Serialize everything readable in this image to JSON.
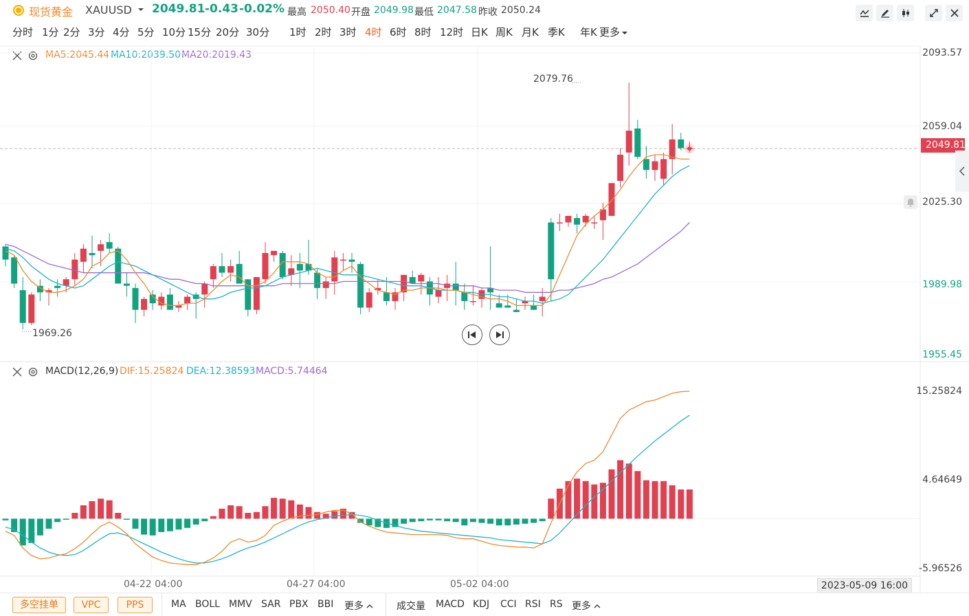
{
  "header": {
    "symbol_name": "现货黄金",
    "symbol_code": "XAUUSD",
    "last_price": "2049.81",
    "change": "-0.43",
    "change_pct": "-0.02%",
    "high_label": "最高",
    "high_value": "2050.40",
    "open_label": "开盘",
    "open_value": "2049.98",
    "low_label": "最低",
    "low_value": "2047.58",
    "prev_close_label": "昨收",
    "prev_close_value": "2050.24"
  },
  "periods": [
    "分时",
    "1分",
    "2分",
    "3分",
    "4分",
    "5分",
    "10分",
    "15分",
    "20分",
    "30分",
    "1时",
    "2时",
    "3时",
    "4时",
    "6时",
    "8时",
    "12时",
    "日K",
    "周K",
    "月K",
    "季K",
    "年K",
    "更多"
  ],
  "active_period": "4时",
  "main_legend": {
    "ma5": "MA5:2045.44",
    "ma10": "MA10:2039.50",
    "ma20": "MA20:2019.43"
  },
  "macd_legend": {
    "name": "MACD(12,26,9)",
    "dif": "DIF:15.25824",
    "dea": "DEA:12.38593",
    "macd": "MACD:5.74464"
  },
  "price_axis": [
    "2093.57",
    "2059.04",
    "2025.30",
    "1989.98",
    "1955.45"
  ],
  "current_price_tag": "2049.81",
  "macd_axis": [
    "15.25824",
    "4.64649",
    "-5.96526"
  ],
  "high_marker": "2079.76",
  "low_marker": "1969.26",
  "x_labels": [
    "04-22 04:00",
    "04-27 04:00",
    "05-02 04:00"
  ],
  "cursor_time": "2023-05-09 16:00",
  "bottom_chips": [
    "多空挂单",
    "VPC",
    "PPS"
  ],
  "main_indicators": [
    "MA",
    "BOLL",
    "MMV",
    "SAR",
    "PBX",
    "BBI",
    "更多"
  ],
  "sub_indicators": [
    "成交量",
    "MACD",
    "KDJ",
    "CCI",
    "RSI",
    "RS",
    "更多"
  ],
  "colors": {
    "up": "#e0404f",
    "down": "#11a37f",
    "ma5": "#f08a2c",
    "ma10": "#1eb3c9",
    "ma20": "#9a6ad6",
    "active": "#f0642c"
  },
  "chart_data": {
    "type": "candlestick",
    "y_range": [
      1955.45,
      2093.57
    ],
    "candles": [
      [
        2005,
        2006,
        1996,
        1999
      ],
      [
        2000,
        2001,
        1986,
        1988
      ],
      [
        1985,
        1991,
        1967,
        1970
      ],
      [
        1970,
        1984,
        1969,
        1983
      ],
      [
        1987,
        1990,
        1980,
        1984
      ],
      [
        1984,
        1986,
        1978,
        1985
      ],
      [
        1987,
        1990,
        1982,
        1986
      ],
      [
        1987,
        1991,
        1984,
        1990
      ],
      [
        1990,
        2002,
        1987,
        1999
      ],
      [
        1998,
        2006,
        1993,
        2004
      ],
      [
        2002,
        2010,
        1995,
        2001
      ],
      [
        2003,
        2008,
        1996,
        2006
      ],
      [
        2007,
        2011,
        2002,
        2004
      ],
      [
        2004,
        2005,
        1988,
        1988
      ],
      [
        1988,
        1993,
        1982,
        1987
      ],
      [
        1986,
        1988,
        1970,
        1976
      ],
      [
        1976,
        1982,
        1973,
        1981
      ],
      [
        1983,
        1985,
        1976,
        1979
      ],
      [
        1978,
        1984,
        1976,
        1982
      ],
      [
        1983,
        1986,
        1976,
        1976
      ],
      [
        1977,
        1980,
        1975,
        1978
      ],
      [
        1979,
        1983,
        1976,
        1982
      ],
      [
        1983,
        1984,
        1972,
        1981
      ],
      [
        1983,
        1989,
        1977,
        1988
      ],
      [
        1990,
        1997,
        1986,
        1996
      ],
      [
        1996,
        2002,
        1991,
        1993
      ],
      [
        1993,
        1999,
        1989,
        1996
      ],
      [
        1997,
        2003,
        1990,
        1988
      ],
      [
        1990,
        1990,
        1973,
        1976
      ],
      [
        1976,
        1991,
        1974,
        1991
      ],
      [
        1990,
        2007,
        1988,
        2002
      ],
      [
        2001,
        2003,
        1998,
        2003
      ],
      [
        2002,
        2003,
        1990,
        1991
      ],
      [
        1992,
        2001,
        1987,
        1995
      ],
      [
        1997,
        2002,
        1986,
        1994
      ],
      [
        1997,
        2008,
        1992,
        1994
      ],
      [
        1993,
        1995,
        1981,
        1986
      ],
      [
        1986,
        1991,
        1981,
        1989
      ],
      [
        1989,
        2003,
        1983,
        2000
      ],
      [
        1999,
        2002,
        1994,
        1999
      ],
      [
        1999,
        2002,
        1993,
        1998
      ],
      [
        1997,
        1998,
        1974,
        1977
      ],
      [
        1977,
        1986,
        1975,
        1984
      ],
      [
        1985,
        1990,
        1983,
        1986
      ],
      [
        1984,
        1991,
        1978,
        1980
      ],
      [
        1980,
        1986,
        1976,
        1984
      ],
      [
        1984,
        1991,
        1980,
        1992
      ],
      [
        1991,
        1994,
        1989,
        1988
      ],
      [
        1989,
        1993,
        1983,
        1992
      ],
      [
        1989,
        1991,
        1978,
        1983
      ],
      [
        1982,
        1991,
        1979,
        1985
      ],
      [
        1986,
        1992,
        1980,
        1988
      ],
      [
        1988,
        1998,
        1978,
        1985
      ],
      [
        1984,
        1988,
        1976,
        1980
      ],
      [
        1980,
        1987,
        1978,
        1980
      ],
      [
        1981,
        1986,
        1977,
        1985
      ],
      [
        1986,
        2005,
        1976,
        1984
      ],
      [
        1979,
        1983,
        1977,
        1977
      ],
      [
        1978,
        1983,
        1977,
        1977
      ],
      [
        1976,
        1981,
        1975,
        1975
      ],
      [
        1979,
        1982,
        1976,
        1980
      ],
      [
        1978,
        1983,
        1976,
        1976
      ],
      [
        1980,
        1986,
        1973,
        1982
      ],
      [
        2016,
        2018,
        1980,
        1990
      ],
      [
        2016,
        2020,
        2012,
        2016
      ],
      [
        2016,
        2019,
        2014,
        2019
      ],
      [
        2018,
        2020,
        2011,
        2015
      ],
      [
        2016,
        2020,
        2014,
        2019
      ],
      [
        2016,
        2019,
        2013,
        2016
      ],
      [
        2017,
        2025,
        2008,
        2022
      ],
      [
        2019,
        2029,
        2019,
        2034
      ],
      [
        2035,
        2050,
        2032,
        2047
      ],
      [
        2048,
        2080,
        2042,
        2058
      ],
      [
        2059,
        2063,
        2045,
        2046
      ],
      [
        2045,
        2051,
        2036,
        2040
      ],
      [
        2040,
        2047,
        2035,
        2044
      ],
      [
        2036,
        2048,
        2033,
        2045
      ],
      [
        2045,
        2061,
        2038,
        2054
      ],
      [
        2054,
        2057,
        2049,
        2050
      ],
      [
        2050,
        2053,
        2048,
        2050
      ]
    ],
    "ma5": [
      2003,
      2001,
      1994,
      1989,
      1986,
      1984,
      1984,
      1985,
      1987,
      1990,
      1996,
      1998,
      2002,
      2003,
      1999,
      1993,
      1988,
      1982,
      1979,
      1978,
      1978,
      1979,
      1979,
      1981,
      1985,
      1989,
      1992,
      1991,
      1987,
      1987,
      1989,
      1993,
      1998,
      1998,
      1998,
      1997,
      1993,
      1991,
      1991,
      1994,
      1996,
      1991,
      1988,
      1985,
      1984,
      1983,
      1985,
      1985,
      1986,
      1986,
      1986,
      1985,
      1985,
      1984,
      1983,
      1982,
      1981,
      1981,
      1980,
      1978,
      1978,
      1978,
      1978,
      1983,
      1992,
      2001,
      2010,
      2015,
      2019,
      2022,
      2026,
      2031,
      2037,
      2042,
      2046,
      2047,
      2047,
      2046,
      2045,
      2045
    ],
    "ma10": [
      2004,
      2003,
      2000,
      1996,
      1993,
      1990,
      1988,
      1987,
      1986,
      1987,
      1990,
      1993,
      1996,
      1998,
      1997,
      1996,
      1994,
      1992,
      1990,
      1988,
      1986,
      1984,
      1982,
      1981,
      1981,
      1982,
      1984,
      1985,
      1986,
      1986,
      1987,
      1989,
      1991,
      1992,
      1993,
      1994,
      1995,
      1994,
      1993,
      1992,
      1992,
      1992,
      1991,
      1990,
      1989,
      1988,
      1987,
      1987,
      1987,
      1986,
      1985,
      1985,
      1985,
      1984,
      1984,
      1983,
      1983,
      1982,
      1982,
      1981,
      1980,
      1980,
      1979,
      1980,
      1981,
      1983,
      1987,
      1991,
      1995,
      1999,
      2004,
      2009,
      2014,
      2019,
      2024,
      2029,
      2033,
      2037,
      2040,
      2042
    ],
    "ma20": [
      2006,
      2005,
      2003,
      2001,
      1999,
      1997,
      1996,
      1995,
      1994,
      1993,
      1993,
      1993,
      1993,
      1993,
      1993,
      1993,
      1993,
      1992,
      1991,
      1990,
      1990,
      1989,
      1988,
      1988,
      1987,
      1987,
      1987,
      1987,
      1987,
      1987,
      1987,
      1987,
      1988,
      1988,
      1988,
      1988,
      1988,
      1988,
      1988,
      1989,
      1989,
      1989,
      1989,
      1989,
      1989,
      1989,
      1989,
      1988,
      1988,
      1988,
      1988,
      1987,
      1987,
      1987,
      1987,
      1986,
      1986,
      1985,
      1985,
      1985,
      1984,
      1984,
      1984,
      1984,
      1985,
      1985,
      1986,
      1987,
      1988,
      1990,
      1991,
      1993,
      1995,
      1997,
      2000,
      2003,
      2006,
      2009,
      2012,
      2016
    ],
    "macd_range": [
      -5.96526,
      15.25824
    ],
    "macd_hist": [
      -0.2,
      -1.6,
      -3.2,
      -2.9,
      -2.0,
      -1.2,
      -0.4,
      -0.1,
      0.7,
      1.6,
      2.1,
      2.4,
      2.2,
      0.7,
      -0.1,
      -1.2,
      -1.9,
      -2.0,
      -1.6,
      -1.5,
      -1.3,
      -1.1,
      -0.7,
      -0.3,
      0.3,
      1.2,
      1.6,
      1.5,
      0.7,
      0.8,
      1.5,
      2.5,
      2.4,
      2.2,
      1.7,
      1.4,
      0.8,
      0.6,
      0.9,
      1.2,
      0.8,
      -0.5,
      -0.8,
      -1.0,
      -1.1,
      -1.0,
      -0.6,
      -0.4,
      -0.3,
      -0.2,
      -0.2,
      -0.3,
      -0.4,
      -0.8,
      -0.4,
      -0.5,
      -0.6,
      -0.8,
      -0.8,
      -0.7,
      -0.6,
      -0.5,
      -0.3,
      2.4,
      3.6,
      4.5,
      4.8,
      4.5,
      4.1,
      4.3,
      5.9,
      7.0,
      6.6,
      5.7,
      4.6,
      4.5,
      4.5,
      4.0,
      3.5,
      3.5
    ],
    "dif": [
      -1.5,
      -2.0,
      -3.5,
      -4.4,
      -4.8,
      -4.7,
      -4.4,
      -4.2,
      -3.6,
      -2.8,
      -1.8,
      -0.9,
      -0.4,
      -1.0,
      -1.8,
      -3.0,
      -3.8,
      -4.6,
      -5.0,
      -5.3,
      -5.4,
      -5.5,
      -5.5,
      -5.2,
      -4.7,
      -3.9,
      -2.8,
      -2.4,
      -2.8,
      -2.6,
      -2.0,
      -0.8,
      -0.3,
      0.1,
      0.3,
      0.4,
      0.5,
      0.8,
      1.0,
      1.0,
      0.6,
      -0.4,
      -0.9,
      -1.3,
      -1.6,
      -1.7,
      -1.8,
      -1.9,
      -1.9,
      -1.9,
      -1.9,
      -2.0,
      -2.3,
      -2.4,
      -2.4,
      -2.7,
      -3.0,
      -3.2,
      -3.3,
      -3.4,
      -3.4,
      -3.5,
      -3.0,
      -0.5,
      1.8,
      4.0,
      5.6,
      6.6,
      7.0,
      8.0,
      10.0,
      12.0,
      13.0,
      13.5,
      14.0,
      14.2,
      14.6,
      15.0,
      15.2,
      15.25824
    ],
    "dea": [
      -1.0,
      -1.3,
      -2.0,
      -2.8,
      -3.5,
      -4.0,
      -4.3,
      -4.4,
      -4.3,
      -3.8,
      -3.1,
      -2.4,
      -1.8,
      -1.7,
      -2.0,
      -2.5,
      -3.0,
      -3.5,
      -4.0,
      -4.4,
      -4.8,
      -5.1,
      -5.3,
      -5.3,
      -5.1,
      -4.8,
      -4.4,
      -3.9,
      -3.5,
      -3.2,
      -2.8,
      -2.3,
      -1.8,
      -1.3,
      -0.8,
      -0.4,
      -0.1,
      0.1,
      0.3,
      0.4,
      0.5,
      0.4,
      0.2,
      -0.2,
      -0.5,
      -0.8,
      -1.1,
      -1.3,
      -1.5,
      -1.6,
      -1.7,
      -1.8,
      -1.9,
      -2.0,
      -2.1,
      -2.2,
      -2.3,
      -2.5,
      -2.6,
      -2.7,
      -2.8,
      -2.9,
      -3.0,
      -2.6,
      -1.7,
      -0.6,
      0.5,
      1.6,
      2.6,
      3.5,
      4.5,
      5.5,
      6.5,
      7.5,
      8.4,
      9.3,
      10.1,
      10.9,
      11.7,
      12.38593
    ]
  }
}
